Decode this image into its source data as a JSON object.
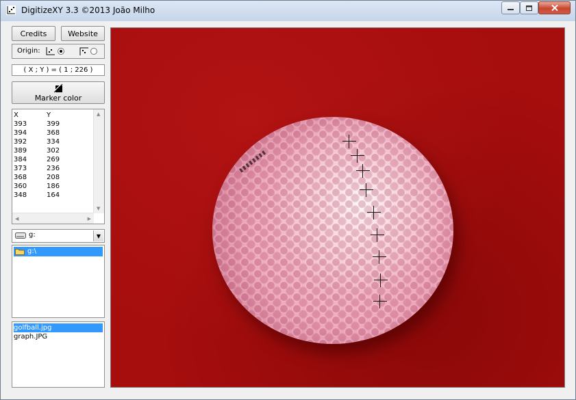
{
  "window": {
    "title": "DigitizeXY 3.3 ©2013 João Milho",
    "icons": {
      "app": "chart-icon",
      "minimize": "minimize-icon",
      "maximize": "maximize-icon",
      "close": "close-icon"
    }
  },
  "toolbar": {
    "credits_label": "Credits",
    "website_label": "Website",
    "origin_label": "Origin:",
    "origin_selected": "bottom-left",
    "coords_text": "( X ; Y ) = ( 1 ; 226 )",
    "marker_color_label": "Marker color"
  },
  "points": {
    "headers": {
      "x": "X",
      "y": "Y"
    },
    "rows": [
      {
        "x": "393",
        "y": "399"
      },
      {
        "x": "394",
        "y": "368"
      },
      {
        "x": "392",
        "y": "334"
      },
      {
        "x": "389",
        "y": "302"
      },
      {
        "x": "384",
        "y": "269"
      },
      {
        "x": "373",
        "y": "236"
      },
      {
        "x": "368",
        "y": "208"
      },
      {
        "x": "360",
        "y": "186"
      },
      {
        "x": "348",
        "y": "164"
      }
    ]
  },
  "drive": {
    "value": "g:"
  },
  "directories": {
    "items": [
      "g:\\"
    ],
    "selected": 0
  },
  "files": {
    "items": [
      "golfball.jpg",
      "graph.JPG"
    ],
    "selected": 0
  },
  "colors": {
    "selection": "#3399ff",
    "background_red": "#a60d0d",
    "ball_pink": "#f0a9bd"
  }
}
